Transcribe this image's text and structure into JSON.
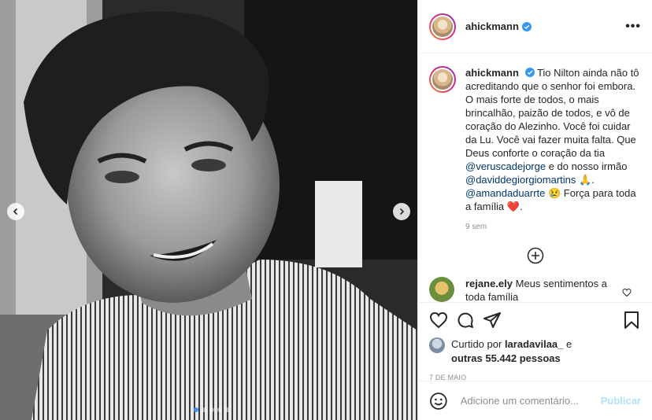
{
  "post": {
    "username": "ahickmann",
    "more_label": "•••"
  },
  "caption": {
    "username": "ahickmann",
    "text_1": "Tio Nilton ainda não tô acreditando que o senhor foi embora. O mais forte de todos, o mais brincalhão, paizão de todos, e vô de coração do Alezinho. Você foi cuidar da Lu. Você vai fazer muita falta. Que Deus conforte o coração da tia ",
    "mention_1": "@veruscadejorge",
    "text_2": " e do nosso irmão ",
    "mention_2": "@daviddegiorgiomartins",
    "text_3": " 🙏. ",
    "mention_3": "@amandaduarrte",
    "text_4": " 😢 Força para toda a família ",
    "heart": "❤️",
    "text_5": ".",
    "time": "9 sem"
  },
  "comment": {
    "username": "rejane.ely",
    "text": "Meus sentimentos a toda família"
  },
  "likes": {
    "prefix": "Curtido por",
    "user": "laradavilaa_",
    "mid": "e",
    "others": "outras 55.442 pessoas"
  },
  "date": "7 DE MAIO",
  "add_comment": {
    "placeholder": "Adicione um comentário...",
    "post_label": "Publicar"
  },
  "carousel": {
    "count": 5,
    "active": 0
  },
  "colors": {
    "link": "#00376b",
    "verified": "#3897f0",
    "publish_disabled": "#b2dffc"
  }
}
